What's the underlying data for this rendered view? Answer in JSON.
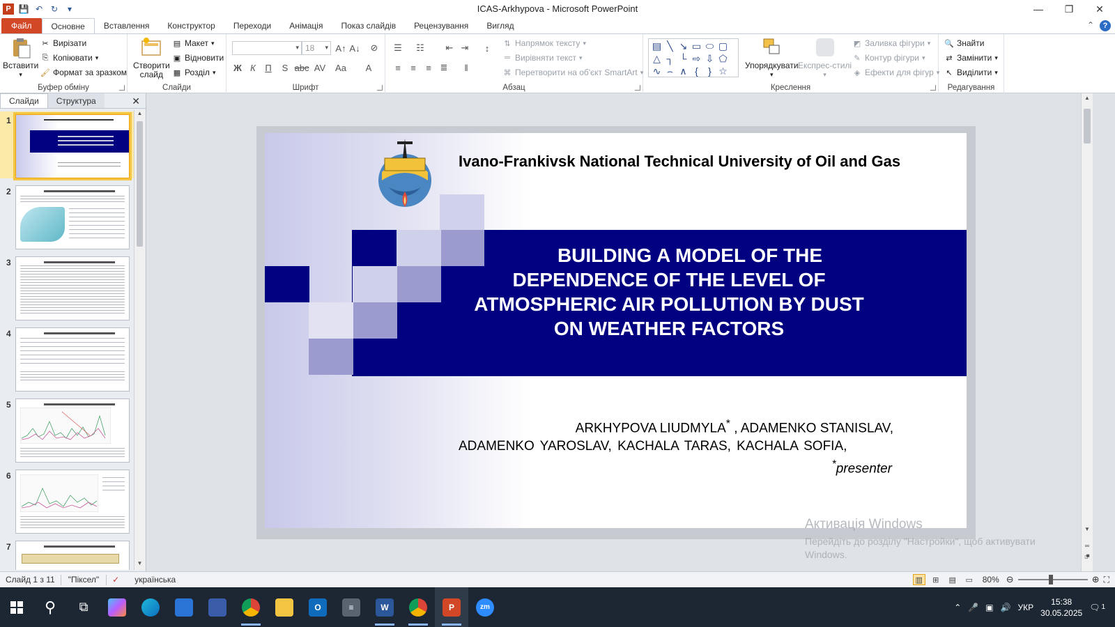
{
  "window": {
    "title": "ICAS-Arkhypova  -  Microsoft PowerPoint",
    "app_logo": "P"
  },
  "tabs": [
    "Файл",
    "Основне",
    "Вставлення",
    "Конструктор",
    "Переходи",
    "Анімація",
    "Показ слайдів",
    "Рецензування",
    "Вигляд"
  ],
  "ribbon": {
    "clipboard": {
      "paste": "Вставити",
      "cut": "Вирізати",
      "copy": "Копіювати",
      "format_painter": "Формат за зразком",
      "label": "Буфер обміну"
    },
    "slides": {
      "new_slide_1": "Створити",
      "new_slide_2": "слайд",
      "layout": "Макет",
      "reset": "Відновити",
      "section": "Розділ",
      "label": "Слайди"
    },
    "font": {
      "size": "18",
      "label": "Шрифт"
    },
    "paragraph": {
      "text_direction": "Напрямок тексту",
      "align_text": "Вирівняти текст",
      "smartart": "Перетворити на об'єкт SmartArt",
      "label": "Абзац"
    },
    "drawing": {
      "arrange": "Упорядкувати",
      "quick_styles": "Експрес-стилі",
      "shape_fill": "Заливка фігури",
      "shape_outline": "Контур фігури",
      "shape_effects": "Ефекти для фігур",
      "label": "Креслення"
    },
    "editing": {
      "find": "Знайти",
      "replace": "Замінити",
      "select": "Виділити",
      "label": "Редагування"
    }
  },
  "panel": {
    "tab_slides": "Слайди",
    "tab_outline": "Структура",
    "thumbnails": [
      {
        "num": "1"
      },
      {
        "num": "2"
      },
      {
        "num": "3"
      },
      {
        "num": "4"
      },
      {
        "num": "5"
      },
      {
        "num": "6"
      },
      {
        "num": "7"
      }
    ]
  },
  "slide": {
    "university": "Ivano-Frankivsk National Technical University of Oil and Gas",
    "title_lines": [
      "BUILDING A MODEL OF THE",
      "DEPENDENCE OF THE LEVEL OF",
      "ATMOSPHERIC AIR POLLUTION BY DUST",
      "ON WEATHER FACTORS"
    ],
    "authors_line1": "ARKHYPOVA  LIUDMYLA",
    "authors_line1_star": "*",
    "authors_line1_rest": " , ADAMENKO  STANISLAV,",
    "authors_line2": "ADAMENKO  YAROSLAV,  KACHALA  TARAS,  KACHALA  SOFIA,",
    "presenter_star": "*",
    "presenter": "presenter",
    "band_color": "#000080"
  },
  "watermark": {
    "line1": "Активація Windows",
    "line2": "Перейдіть до розділу \"Настройки\", щоб активувати",
    "line3": "Windows."
  },
  "statusbar": {
    "slide_info": "Слайд 1 з 11",
    "theme": "\"Піксел\"",
    "language": "українська",
    "zoom": "80%"
  },
  "taskbar": {
    "lang": "УКР",
    "time": "15:38",
    "date": "30.05.2025",
    "notif": "1"
  }
}
